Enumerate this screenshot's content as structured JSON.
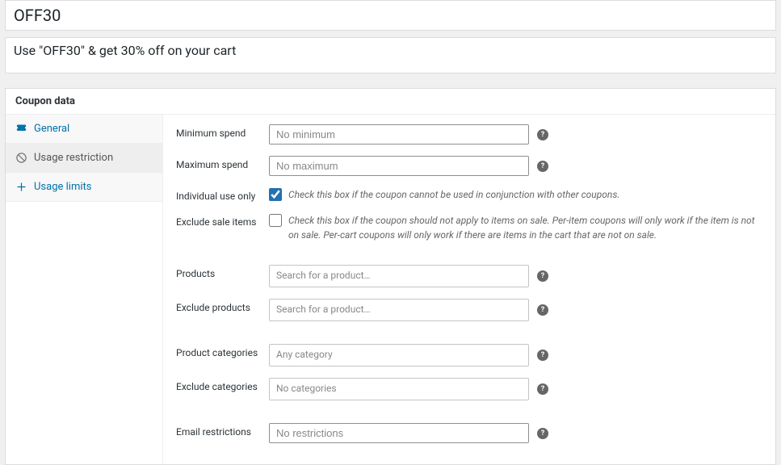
{
  "title": "OFF30",
  "description": "Use \"OFF30\" & get 30% off on your cart",
  "panel_title": "Coupon data",
  "tabs": [
    {
      "label": "General"
    },
    {
      "label": "Usage restriction"
    },
    {
      "label": "Usage limits"
    }
  ],
  "fields": {
    "min_spend": {
      "label": "Minimum spend",
      "placeholder": "No minimum"
    },
    "max_spend": {
      "label": "Maximum spend",
      "placeholder": "No maximum"
    },
    "individual_use": {
      "label": "Individual use only",
      "checked": true,
      "help": "Check this box if the coupon cannot be used in conjunction with other coupons."
    },
    "exclude_sale": {
      "label": "Exclude sale items",
      "checked": false,
      "help": "Check this box if the coupon should not apply to items on sale. Per-item coupons will only work if the item is not on sale. Per-cart coupons will only work if there are items in the cart that are not on sale."
    },
    "products": {
      "label": "Products",
      "placeholder": "Search for a product…"
    },
    "exclude_products": {
      "label": "Exclude products",
      "placeholder": "Search for a product…"
    },
    "product_categories": {
      "label": "Product categories",
      "placeholder": "Any category"
    },
    "exclude_categories": {
      "label": "Exclude categories",
      "placeholder": "No categories"
    },
    "email_restrictions": {
      "label": "Email restrictions",
      "placeholder": "No restrictions"
    }
  }
}
